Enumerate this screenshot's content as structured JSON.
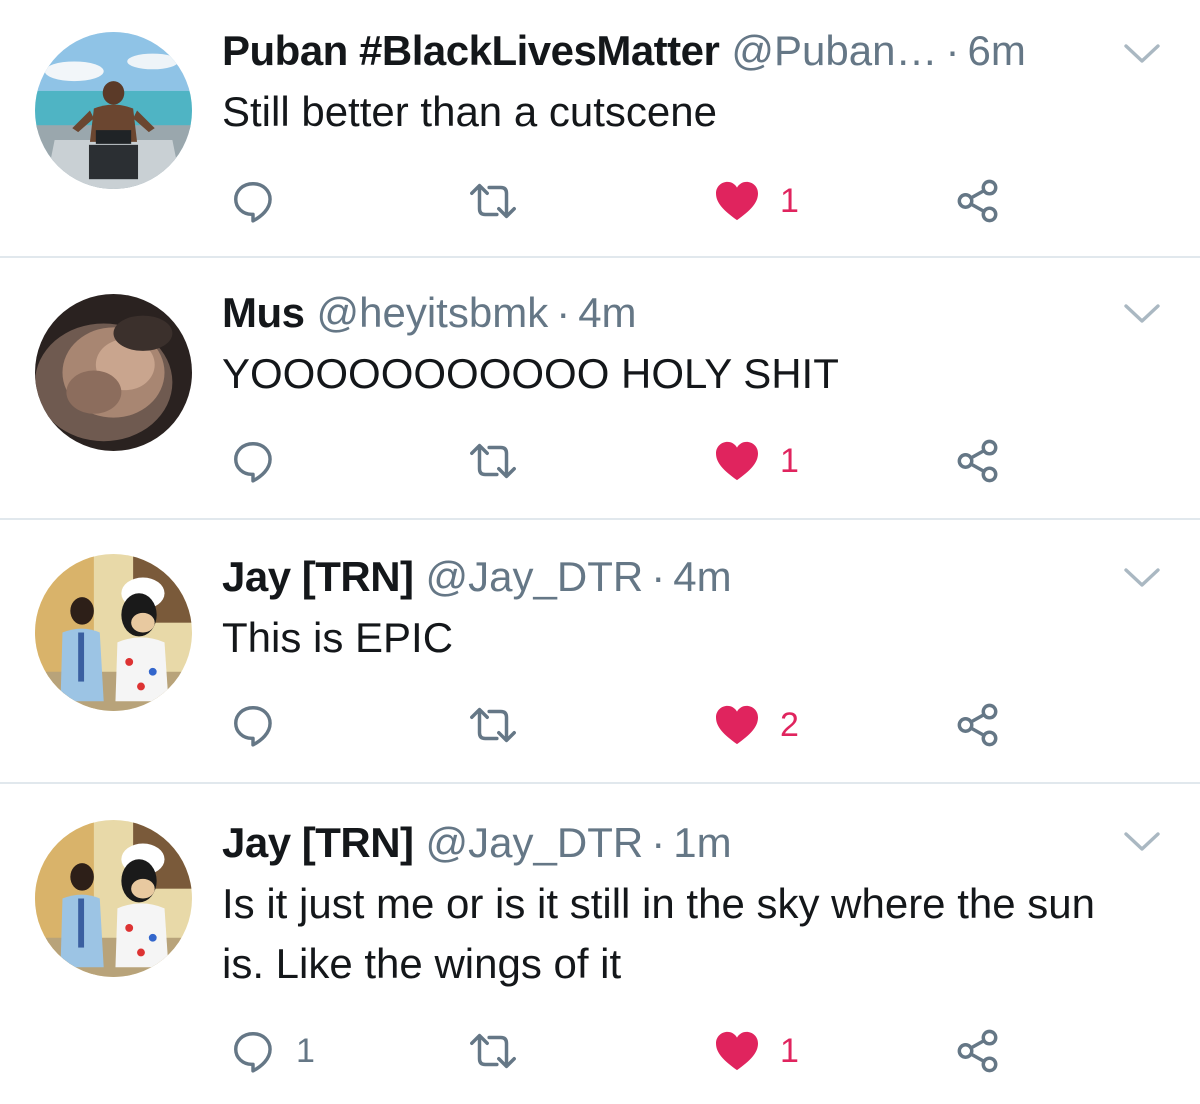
{
  "tweets": [
    {
      "name": "Puban #BlackLivesMatter",
      "handle": "@Puban…",
      "separator": "·",
      "time": "6m",
      "text": "Still better than a cutscene",
      "reply_count": "",
      "like_count": "1",
      "avatar": "man-on-boat-photo"
    },
    {
      "name": "Mus",
      "handle": "@heyitsbmk",
      "separator": "·",
      "time": "4m",
      "text": "YOOOOOOOOOOO HOLY SHIT",
      "reply_count": "",
      "like_count": "1",
      "avatar": "blurred-face-photo"
    },
    {
      "name": "Jay [TRN]",
      "handle": "@Jay_DTR",
      "separator": "·",
      "time": "4m",
      "text": "This is EPIC",
      "reply_count": "",
      "like_count": "2",
      "avatar": "person-with-goofy-photo"
    },
    {
      "name": "Jay [TRN]",
      "handle": "@Jay_DTR",
      "separator": "·",
      "time": "1m",
      "text": "Is it just me or is it still in the sky where the sun is. Like the wings of it",
      "reply_count": "1",
      "like_count": "1",
      "avatar": "person-with-goofy-photo"
    }
  ],
  "icons": {
    "reply": "reply-icon",
    "retweet": "retweet-icon",
    "like": "heart-icon",
    "share": "share-icon",
    "menu": "chevron-down-icon"
  },
  "colors": {
    "like_active": "#e0245e",
    "secondary_text": "#657786",
    "divider": "#e1e8ed"
  }
}
